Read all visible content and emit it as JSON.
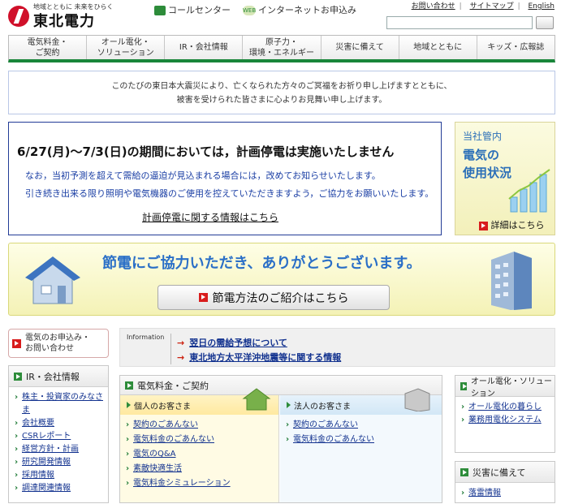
{
  "header": {
    "logo_tagline": "地域とともに 未来をひらく",
    "logo_name": "東北電力",
    "call_center": "コールセンター",
    "net_badge": "WEB",
    "internet_apply": "インターネットお申込み",
    "top_links": [
      "お問い合わせ",
      "サイトマップ",
      "English"
    ],
    "search_value": ""
  },
  "nav": [
    "電気料金・\nご契約",
    "オール電化・\nソリューション",
    "IR・会社情報",
    "原子力・\n環境・エネルギー",
    "災害に備えて",
    "地域とともに",
    "キッズ・広報誌"
  ],
  "condolence": [
    "このたびの東日本大震災により、亡くなられた方々のご冥福をお祈り申し上げますとともに、",
    "被害を受けられた皆さまに心よりお見舞い申し上げます。"
  ],
  "notice": {
    "title": "6/27(月)～7/3(日)の期間においては，計画停電は実施いたしません",
    "body1": "なお，当初予測を超えて需給の逼迫が見込まれる場合には，改めてお知らせいたします。",
    "body2": "引き続き出来る限り照明や電気機器のご使用を控えていただきますよう，ご協力をお願いいたします。",
    "link": "計画停電に関する情報はこちら"
  },
  "usage": {
    "line1": "当社管内",
    "line2": "電気の\n使用状況",
    "detail": "詳細はこちら"
  },
  "saving": {
    "title": "節電にご協力いただき、ありがとうございます。",
    "button": "節電方法のご紹介はこちら"
  },
  "contact": {
    "label": "電気のお申込み・\nお問い合わせ"
  },
  "ir_box": {
    "title": "IR・会社情報",
    "items": [
      "株主・投資家のみなさま",
      "会社概要",
      "CSRレポート",
      "経営方針・計画",
      "研究開発情報",
      "採用情報",
      "調達関連情報"
    ]
  },
  "info": {
    "label": "Information",
    "items": [
      "翌日の需給予想について",
      "東北地方太平洋沖地震等に関する情報"
    ]
  },
  "fee": {
    "title": "電気料金・ご契約",
    "personal": {
      "title": "個人のお客さま",
      "items": [
        "契約のごあんない",
        "電気料金のごあんない",
        "電気のQ&A",
        "素敵快適生活",
        "電気料金シミュレーション"
      ]
    },
    "corporate": {
      "title": "法人のお客さま",
      "items": [
        "契約のごあんない",
        "電気料金のごあんない"
      ]
    }
  },
  "all_electric": {
    "title": "オール電化・ソリューション",
    "items": [
      "オール電化の暮らし",
      "業務用電化システム"
    ]
  },
  "disaster": {
    "title": "災害に備えて",
    "items": [
      "落雷情報"
    ]
  },
  "colors": {
    "brand_green": "#19863a",
    "brand_red": "#d0102a",
    "link_blue": "#12328f",
    "accent_blue": "#2a6fc7"
  }
}
